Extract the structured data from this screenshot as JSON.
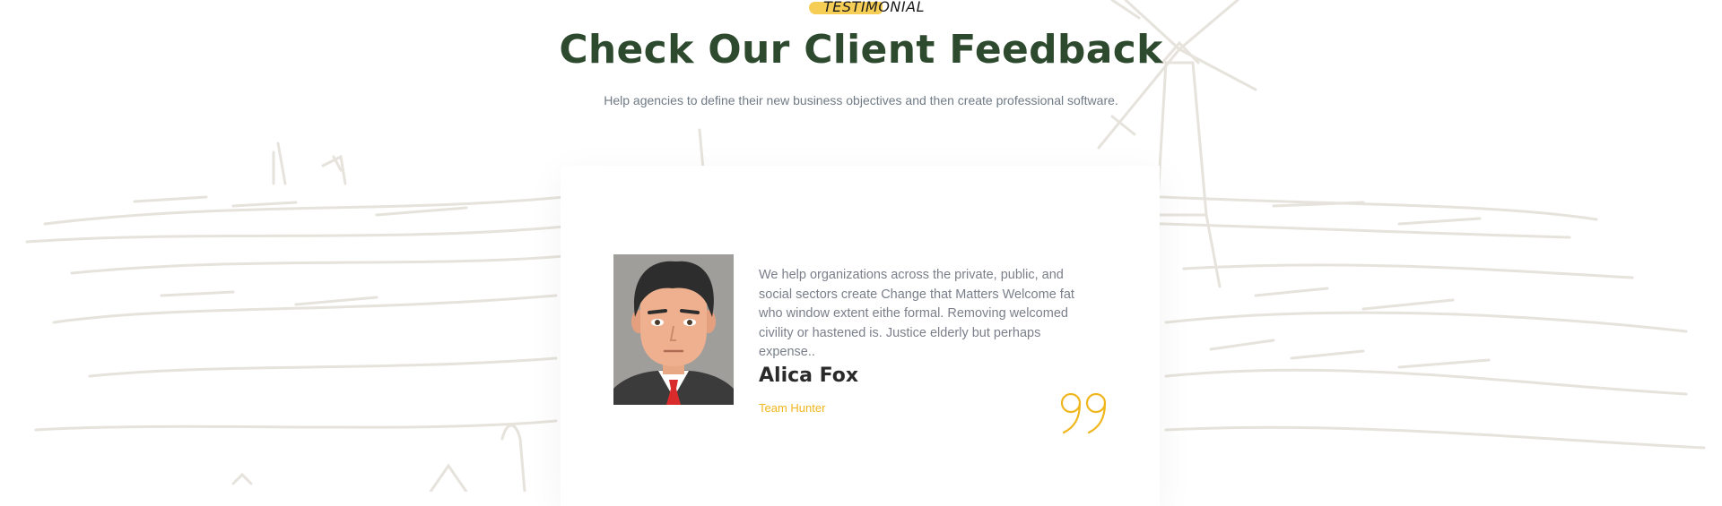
{
  "section": {
    "eyebrow": "TESTIMONIAL",
    "title": "Check Our Client Feedback",
    "subtitle": "Help agencies to define their new business objectives and then create professional software."
  },
  "testimonial": {
    "quote": "We help organizations across the private, public, and social sectors create Change that Matters Welcome fat who window extent eithe formal. Removing welcomed civility or hastened is. Justice elderly but perhaps expense..",
    "name": "Alica Fox",
    "role": "Team Hunter",
    "avatar_icon": "person-avatar",
    "quote_icon": "closing-quote-icon"
  },
  "colors": {
    "heading": "#2e4a2e",
    "accent": "#f0b61d",
    "body_text": "#7a7f8a",
    "sketch": "#e4e1da"
  }
}
